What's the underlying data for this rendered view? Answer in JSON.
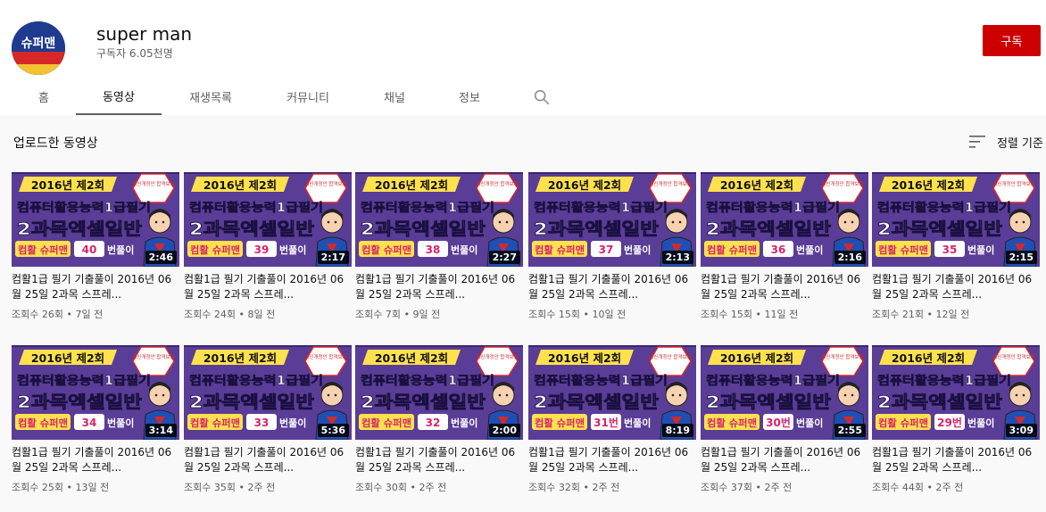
{
  "channel": {
    "name": "super man",
    "subscribers": "구독자 6.05천명",
    "avatar_text": "슈퍼맨",
    "subscribe_label": "구독"
  },
  "tabs": [
    {
      "label": "홈",
      "active": false
    },
    {
      "label": "동영상",
      "active": true
    },
    {
      "label": "재생목록",
      "active": false
    },
    {
      "label": "커뮤니티",
      "active": false
    },
    {
      "label": "채널",
      "active": false
    },
    {
      "label": "정보",
      "active": false
    }
  ],
  "section": {
    "title": "업로드한 동영상",
    "sort_label": "정렬 기준"
  },
  "thumbnail_text": {
    "year": "2016년 제2회",
    "line1": "컴퓨터활용능력1급필기",
    "line2": "2과목엑셀일반",
    "brand": "컴활 슈퍼맨",
    "badge": "최신개정안 합격보장",
    "suffix": "번풀이"
  },
  "videos": [
    {
      "number": "40",
      "duration": "2:46",
      "title": "컴활1급 필기 기출풀이 2016년 06월 25일 2과목 스프레...",
      "views": "조회수 26회",
      "age": "7일 전"
    },
    {
      "number": "39",
      "duration": "2:17",
      "title": "컴활1급 필기 기출풀이 2016년 06월 25일 2과목 스프레...",
      "views": "조회수 24회",
      "age": "8일 전"
    },
    {
      "number": "38",
      "duration": "2:27",
      "title": "컴활1급 필기 기출풀이 2016년 06월 25일 2과목 스프레...",
      "views": "조회수 7회",
      "age": "9일 전"
    },
    {
      "number": "37",
      "duration": "2:13",
      "title": "컴활1급 필기 기출풀이 2016년 06월 25일 2과목 스프레...",
      "views": "조회수 15회",
      "age": "10일 전"
    },
    {
      "number": "36",
      "duration": "2:16",
      "title": "컴활1급 필기 기출풀이 2016년 06월 25일 2과목 스프레...",
      "views": "조회수 15회",
      "age": "11일 전"
    },
    {
      "number": "35",
      "duration": "2:15",
      "title": "컴활1급 필기 기출풀이 2016년 06월 25일 2과목 스프레...",
      "views": "조회수 21회",
      "age": "12일 전"
    },
    {
      "number": "34",
      "duration": "3:14",
      "title": "컴활1급 필기 기출풀이 2016년 06월 25일 2과목 스프레...",
      "views": "조회수 25회",
      "age": "13일 전"
    },
    {
      "number": "33",
      "duration": "5:36",
      "title": "컴활1급 필기 기출풀이 2016년 06월 25일 2과목 스프레...",
      "views": "조회수 35회",
      "age": "2주 전"
    },
    {
      "number": "32",
      "duration": "2:00",
      "title": "컴활1급 필기 기출풀이 2016년 06월 25일 2과목 스프레...",
      "views": "조회수 30회",
      "age": "2주 전"
    },
    {
      "number": "31번",
      "duration": "8:19",
      "title": "컴활1급 필기 기출풀이 2016년 06월 25일 2과목 스프레...",
      "views": "조회수 32회",
      "age": "2주 전"
    },
    {
      "number": "30번",
      "duration": "2:55",
      "title": "컴활1급 필기 기출풀이 2016년 06월 25일 2과목 스프레...",
      "views": "조회수 37회",
      "age": "2주 전"
    },
    {
      "number": "29번",
      "duration": "3:09",
      "title": "컴활1급 필기 기출풀이 2016년 06월 25일 2과목 스프레...",
      "views": "조회수 44회",
      "age": "2주 전"
    }
  ],
  "colors": {
    "subscribe": "#cc0000",
    "thumb_bg": "#5a3d96",
    "thumb_yellow": "#ffe14d",
    "thumb_number": "#d6246e"
  }
}
